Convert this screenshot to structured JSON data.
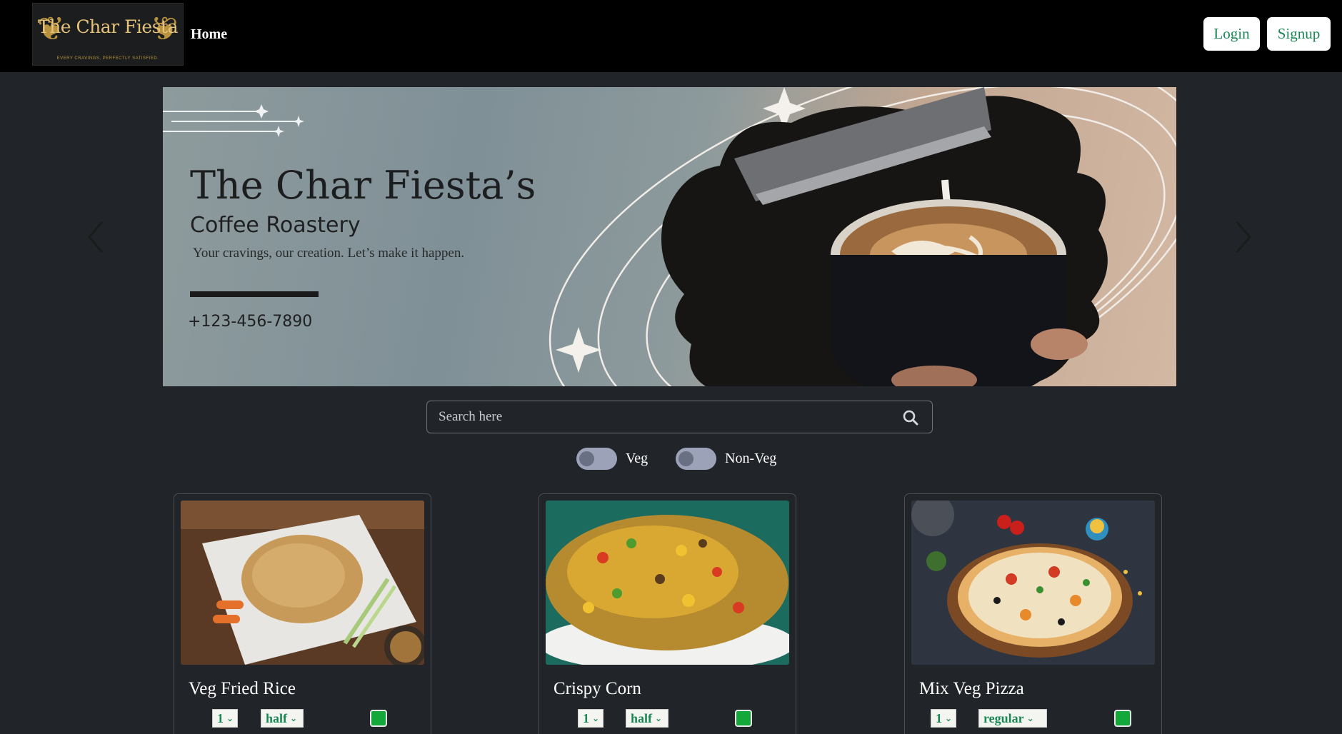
{
  "navbar": {
    "logo_text": "The Char Fiesta",
    "logo_tagline": "EVERY CRAVINGS, PERFECTLY SATISFIED.",
    "home_label": "Home",
    "login_label": "Login",
    "signup_label": "Signup"
  },
  "carousel": {
    "title": "The Char Fiesta’s",
    "subtitle": "Coffee Roastery",
    "tagline": "Your cravings, our creation. Let’s make it happen.",
    "phone": "+123-456-7890"
  },
  "search": {
    "placeholder": "Search here"
  },
  "filters": {
    "veg_label": "Veg",
    "nonveg_label": "Non-Veg"
  },
  "cards": [
    {
      "title": "Veg Fried Rice",
      "qty": "1",
      "size": "half"
    },
    {
      "title": "Crispy Corn",
      "qty": "1",
      "size": "half"
    },
    {
      "title": "Mix Veg Pizza",
      "qty": "1",
      "size": "regular"
    }
  ],
  "colors": {
    "accent": "#198754",
    "background": "#212529",
    "navbar": "#000000",
    "checkbox": "#14a83b"
  },
  "icons": {
    "search": "search-icon",
    "prev": "chevron-left-icon",
    "next": "chevron-right-icon"
  }
}
